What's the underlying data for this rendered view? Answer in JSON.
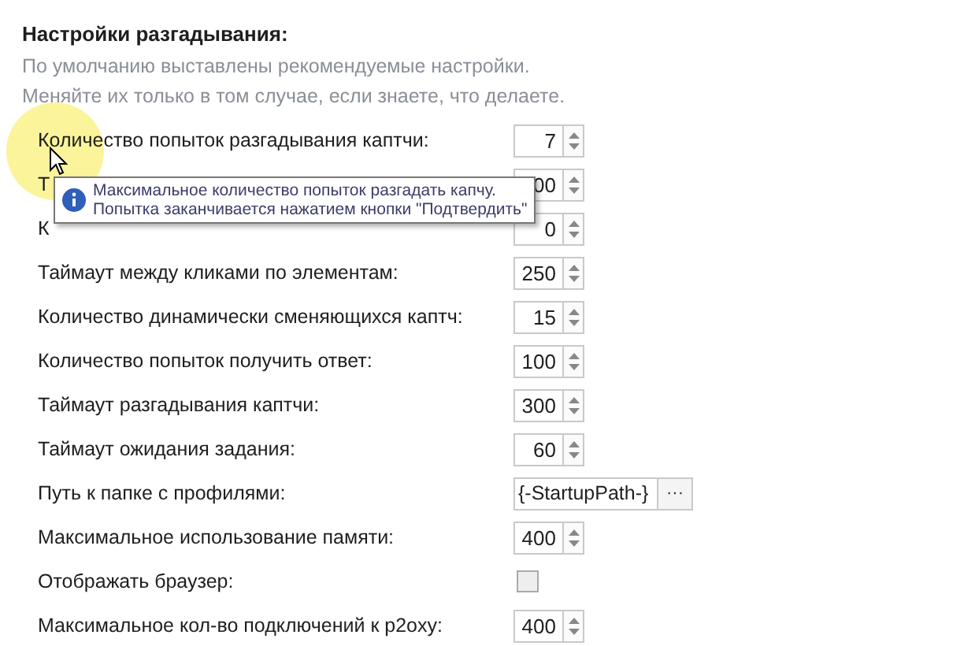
{
  "section": {
    "title": "Настройки разгадывания:",
    "description": [
      "По умолчанию выставлены рекомендуемые настройки.",
      "Меняйте их только в том случае, если знаете, что делаете."
    ]
  },
  "settings": [
    {
      "kind": "spin",
      "label": "Количество попыток разгадывания каптчи:",
      "value": "7"
    },
    {
      "kind": "spin",
      "label": "Т",
      "value": "00"
    },
    {
      "kind": "spin",
      "label": "К",
      "value": "0"
    },
    {
      "kind": "spin",
      "label": "Таймаут между кликами по элементам:",
      "value": "250"
    },
    {
      "kind": "spin",
      "label": "Количество динамически сменяющихся каптч:",
      "value": "15"
    },
    {
      "kind": "spin",
      "label": "Количество попыток получить ответ:",
      "value": "100"
    },
    {
      "kind": "spin",
      "label": "Таймаут разгадывания каптчи:",
      "value": "300"
    },
    {
      "kind": "spin",
      "label": "Таймаут ожидания задания:",
      "value": "60"
    },
    {
      "kind": "path",
      "label": "Путь к папке с профилями:",
      "value": "{-StartupPath-}",
      "button": "···"
    },
    {
      "kind": "spin",
      "label": "Максимальное использование памяти:",
      "value": "400"
    },
    {
      "kind": "checkbox",
      "label": "Отображать браузер:",
      "checked": false
    },
    {
      "kind": "spin",
      "label": "Максимальное кол-во подключений к p2oxy:",
      "value": "400"
    }
  ],
  "tooltip": {
    "lines": [
      "Максимальное количество попыток разгадать капчу.",
      "Попытка заканчивается нажатием кнопки \"Подтвердить\""
    ]
  }
}
